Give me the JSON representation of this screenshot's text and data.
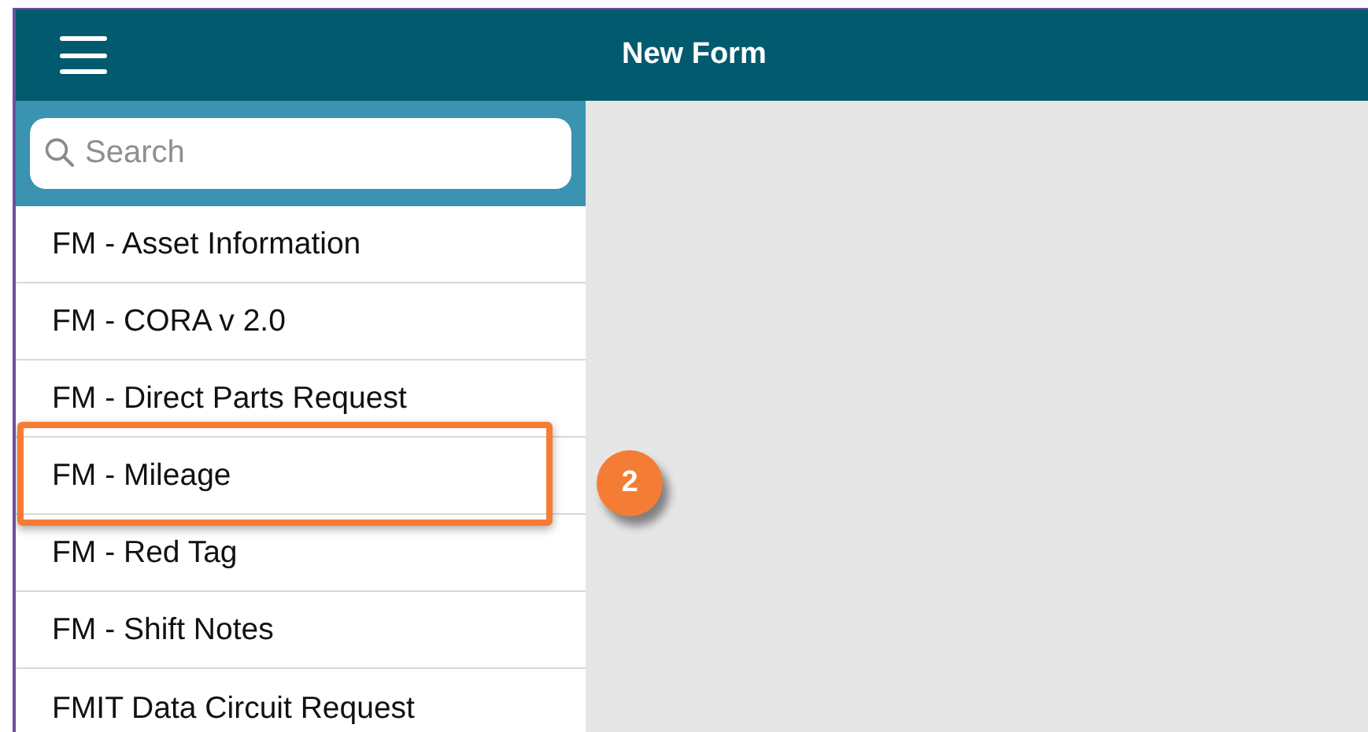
{
  "header": {
    "title": "New Form"
  },
  "search": {
    "placeholder": "Search"
  },
  "forms": [
    {
      "label": "FM - Asset Information",
      "highlighted": false
    },
    {
      "label": "FM - CORA v 2.0",
      "highlighted": false
    },
    {
      "label": "FM - Direct Parts Request",
      "highlighted": false
    },
    {
      "label": "FM - Mileage",
      "highlighted": true
    },
    {
      "label": "FM - Red Tag",
      "highlighted": false
    },
    {
      "label": "FM - Shift Notes",
      "highlighted": false
    },
    {
      "label": "FMIT Data Circuit Request",
      "highlighted": false
    }
  ],
  "callout": {
    "number": "2"
  }
}
